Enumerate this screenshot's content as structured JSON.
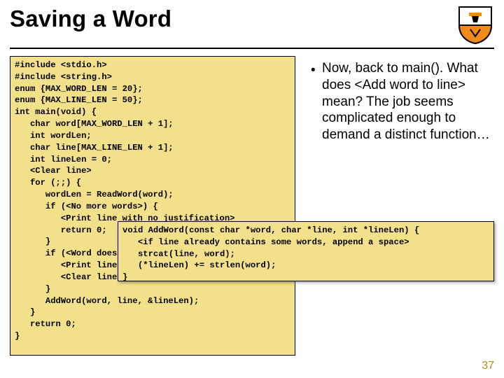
{
  "title": "Saving a Word",
  "bullet": {
    "marker": "•",
    "text": "Now, back to main(). What does <Add word to line> mean? The job seems complicated enough to demand a distinct function…"
  },
  "code_main": "#include <stdio.h>\n#include <string.h>\nenum {MAX_WORD_LEN = 20};\nenum {MAX_LINE_LEN = 50};\nint main(void) {\n   char word[MAX_WORD_LEN + 1];\n   int wordLen;\n   char line[MAX_LINE_LEN + 1];\n   int lineLen = 0;\n   <Clear line>\n   for (;;) {\n      wordLen = ReadWord(word);\n      if (<No more words>) {\n         <Print line with no justification>\n         return 0;\n      }\n      if (<Word doesn't fit on this line>) {\n         <Print line with justification>\n         <Clear line>\n      }\n      AddWord(word, line, &lineLen);\n   }\n   return 0;\n}",
  "code_overlay": "void AddWord(const char *word, char *line, int *lineLen) {\n   <if line already contains some words, append a space>\n   strcat(line, word);\n   (*lineLen) += strlen(word);\n}",
  "page_number": "37",
  "icons": {
    "crest": "princeton-crest-icon"
  }
}
